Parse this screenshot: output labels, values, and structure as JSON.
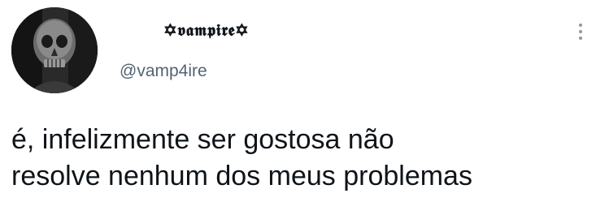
{
  "tweet": {
    "avatar_icon": "skull-avatar-icon",
    "display_name": "✡𝖛𝖆𝖒𝖕𝖎𝖗𝖊✡",
    "handle": "@vamp4ire",
    "more_icon": "more-vertical-icon",
    "text_lines": [
      "é, infelizmente ser gostosa não",
      "resolve nenhum dos meus problemas"
    ]
  },
  "colors": {
    "background": "#ffffff",
    "text": "#0f1419",
    "secondary_text": "#536471",
    "icon_gray": "#8b98a5"
  }
}
